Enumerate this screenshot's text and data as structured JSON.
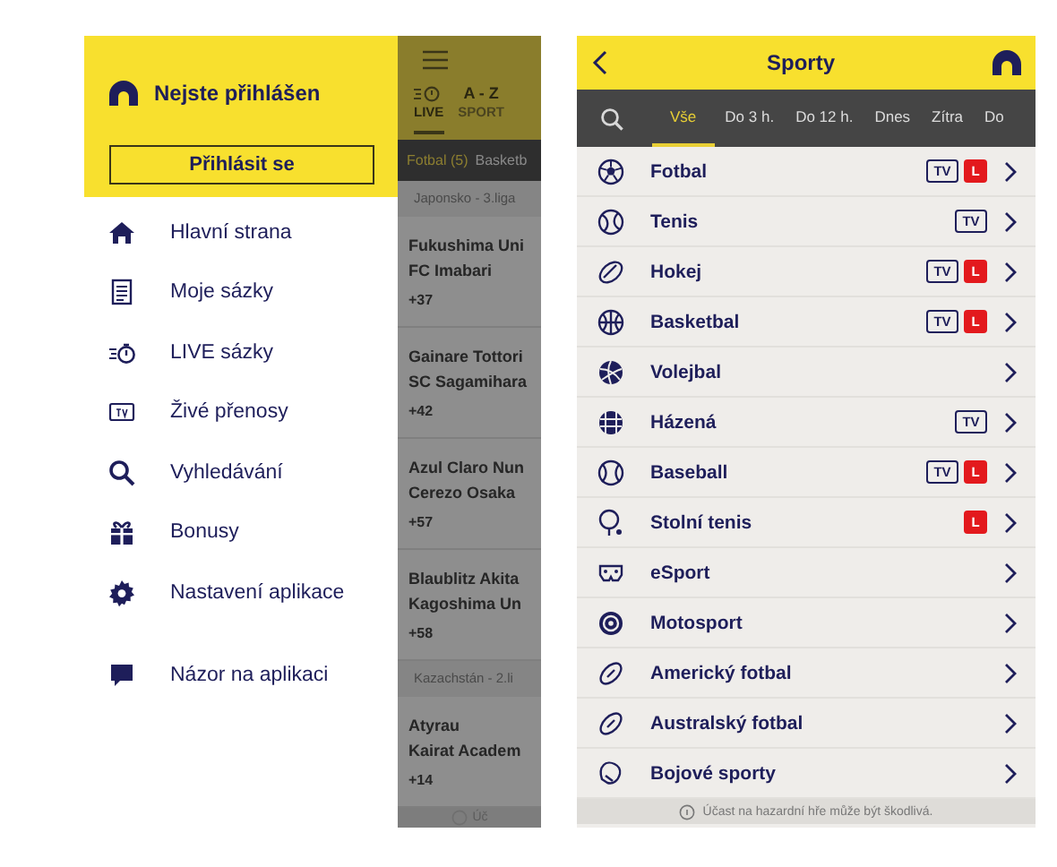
{
  "drawer": {
    "user_label": "Nejste přihlášen",
    "login_button": "Přihlásit se",
    "items": [
      {
        "label": "Hlavní strana"
      },
      {
        "label": "Moje sázky"
      },
      {
        "label": "LIVE sázky"
      },
      {
        "label": "Živé přenosy"
      },
      {
        "label": "Vyhledávání"
      },
      {
        "label": "Bonusy"
      },
      {
        "label": "Nastavení aplikace"
      }
    ],
    "feedback_items": [
      {
        "label": "Názor na aplikaci"
      }
    ]
  },
  "background_app": {
    "tabs": [
      {
        "label": "LIVE",
        "selected": true
      },
      {
        "label": "SPORT",
        "title": "A - Z",
        "selected": false
      }
    ],
    "sport_tabs": [
      {
        "label": "Fotbal (5)",
        "selected": true
      },
      {
        "label": "Basketb",
        "selected": false
      }
    ],
    "groups": [
      {
        "league": "Japonsko - 3.liga",
        "matches": [
          {
            "home": "Fukushima Uni",
            "away": "FC Imabari",
            "count": "+37"
          },
          {
            "home": "Gainare Tottori",
            "away": "SC Sagamihara",
            "count": "+42"
          },
          {
            "home": "Azul Claro Nun",
            "away": "Cerezo Osaka",
            "count": "+57"
          },
          {
            "home": "Blaublitz Akita",
            "away": "Kagoshima Un",
            "count": "+58"
          }
        ]
      },
      {
        "league": "Kazachstán - 2.li",
        "matches": [
          {
            "home": "Atyrau",
            "away": "Kairat Academ",
            "count": "+14"
          }
        ]
      }
    ],
    "footer": "Úč"
  },
  "sports_screen": {
    "title": "Sporty",
    "filters": [
      {
        "label": "Vše",
        "selected": true
      },
      {
        "label": "Do 3 h.",
        "selected": false
      },
      {
        "label": "Do 12 h.",
        "selected": false
      },
      {
        "label": "Dnes",
        "selected": false
      },
      {
        "label": "Zítra",
        "selected": false
      },
      {
        "label": "Do",
        "selected": false
      }
    ],
    "sports": [
      {
        "name": "Fotbal",
        "tv": true,
        "live": true,
        "tv_label": "TV",
        "live_label": "L"
      },
      {
        "name": "Tenis",
        "tv": true,
        "live": false,
        "tv_label": "TV"
      },
      {
        "name": "Hokej",
        "tv": true,
        "live": true,
        "tv_label": "TV",
        "live_label": "L"
      },
      {
        "name": "Basketbal",
        "tv": true,
        "live": true,
        "tv_label": "TV",
        "live_label": "L"
      },
      {
        "name": "Volejbal",
        "tv": false,
        "live": false
      },
      {
        "name": "Házená",
        "tv": true,
        "live": false,
        "tv_label": "TV"
      },
      {
        "name": "Baseball",
        "tv": true,
        "live": true,
        "tv_label": "TV",
        "live_label": "L"
      },
      {
        "name": "Stolní tenis",
        "tv": false,
        "live": true,
        "live_label": "L"
      },
      {
        "name": "eSport",
        "tv": false,
        "live": false
      },
      {
        "name": "Motosport",
        "tv": false,
        "live": false
      },
      {
        "name": "Americký fotbal",
        "tv": false,
        "live": false
      },
      {
        "name": "Australský fotbal",
        "tv": false,
        "live": false
      },
      {
        "name": "Bojové sporty",
        "tv": false,
        "live": false
      }
    ],
    "footer": "Účast na hazardní hře může být škodlivá."
  }
}
